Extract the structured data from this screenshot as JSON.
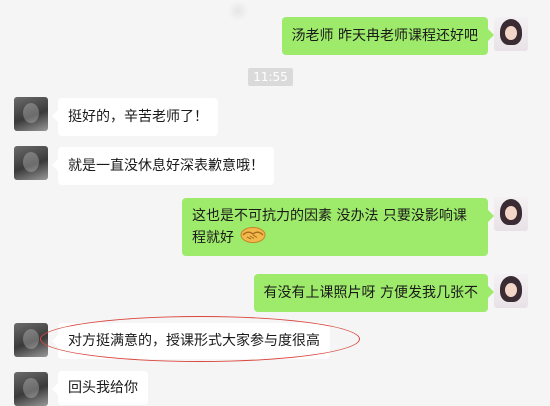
{
  "messages": [
    {
      "from": "self",
      "text": "汤老师  昨天冉老师课程还好吧"
    },
    {
      "from": "peer",
      "text": "挺好的，辛苦老师了！"
    },
    {
      "from": "peer",
      "text": "就是一直没休息好深表歉意哦！"
    },
    {
      "from": "self",
      "line1": "这也是不可抗力的因素 没办法    只要没影响课",
      "line2": "程就好",
      "emoji": "handshake-icon"
    },
    {
      "from": "self",
      "text": "有没有上课照片呀  方便发我几张不"
    },
    {
      "from": "peer",
      "text": "对方挺满意的，授课形式大家参与度很高"
    },
    {
      "from": "peer",
      "text": "回头我给你"
    }
  ],
  "timestamp": "11:55",
  "colors": {
    "self_bubble": "#9eea6a",
    "peer_bubble": "#ffffff",
    "background": "#f5f5f5",
    "highlight": "#d9473f"
  }
}
